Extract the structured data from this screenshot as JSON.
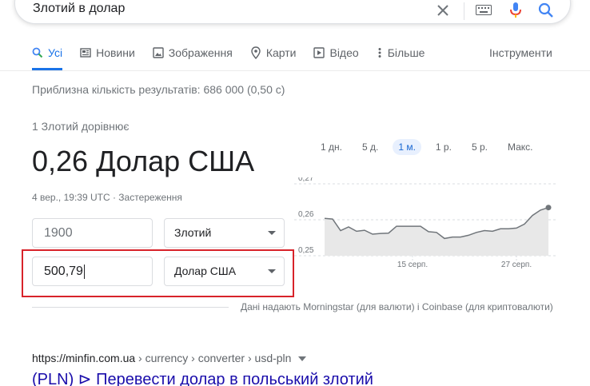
{
  "search": {
    "query": "Злотий в долар"
  },
  "tabs": [
    {
      "label": "Усі",
      "icon": "search-icon"
    },
    {
      "label": "Новини",
      "icon": "news-icon"
    },
    {
      "label": "Зображення",
      "icon": "image-icon"
    },
    {
      "label": "Карти",
      "icon": "map-pin-icon"
    },
    {
      "label": "Відео",
      "icon": "video-icon"
    },
    {
      "label": "Більше",
      "icon": "more-vert-icon"
    }
  ],
  "tools_label": "Інструменти",
  "result_stats": "Приблизна кількість результатів: 686 000 (0,50 с)",
  "converter": {
    "from_text": "1 Злотий дорівнює",
    "result": "0,26 Долар США",
    "timestamp": "4 вер., 19:39 UTC",
    "separator": " · ",
    "disclaimer": "Застереження",
    "amount_from": "1900",
    "currency_from": "Злотий",
    "amount_to": "500,79",
    "currency_to": "Долар США",
    "attribution": "Дані надають Morningstar (для валюти) і Coinbase (для криптовалюти)",
    "ranges": [
      "1 дн.",
      "5 д.",
      "1 м.",
      "1 р.",
      "5 р.",
      "Макс."
    ],
    "active_range": "1 м."
  },
  "chart_data": {
    "type": "area",
    "y_ticks": [
      "0,27",
      "0,26",
      "0,25"
    ],
    "ylim": [
      0.25,
      0.27
    ],
    "x_ticks": [
      "15 серп.",
      "27 серп."
    ],
    "values": [
      0.2604,
      0.2602,
      0.257,
      0.258,
      0.2568,
      0.2571,
      0.256,
      0.2562,
      0.2563,
      0.2582,
      0.2582,
      0.2582,
      0.2582,
      0.2567,
      0.2565,
      0.2548,
      0.2552,
      0.2552,
      0.2557,
      0.2565,
      0.257,
      0.2568,
      0.2575,
      0.2575,
      0.2577,
      0.2588,
      0.2612,
      0.2627,
      0.2634
    ],
    "line_color": "#70757a",
    "fill_color": "#e8e8e8"
  },
  "result": {
    "domain": "https://minfin.com.ua",
    "path": " › currency › converter › usd-pln",
    "title": "(PLN) ⊳ Перевести долар в польський злотий"
  }
}
